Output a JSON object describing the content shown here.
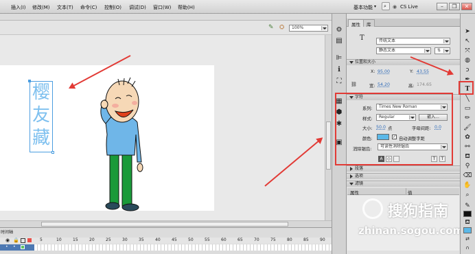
{
  "menubar": {
    "items": [
      "插入(I)",
      "修改(M)",
      "文本(T)",
      "命令(C)",
      "控制(O)",
      "调试(D)",
      "窗口(W)",
      "帮助(H)"
    ],
    "workspace": "基本功能",
    "cslive": "CS Live"
  },
  "editbar": {
    "zoom": "100%"
  },
  "stage": {
    "vertical_text": [
      "樱",
      "友",
      "藏"
    ]
  },
  "timeline": {
    "title": "时间轴",
    "frames": [
      "5",
      "10",
      "15",
      "20",
      "25",
      "30",
      "35",
      "40",
      "45",
      "50",
      "55",
      "60",
      "65",
      "70",
      "75",
      "80",
      "85",
      "90"
    ]
  },
  "properties": {
    "tabs": [
      "属性",
      "库"
    ],
    "tool_icon": "T",
    "text_engine": "传统文本",
    "text_type": "静态文本",
    "position_section": "位置和大小",
    "x_label": "X:",
    "x_value": "95.00",
    "y_label": "Y:",
    "y_value": "43.55",
    "w_label": "宽:",
    "w_value": "54.20",
    "h_label": "高:",
    "h_value": "174.65",
    "char_section": "字符",
    "family_label": "系列:",
    "family_value": "Times New Roman",
    "style_label": "样式:",
    "style_value": "Regular",
    "embed_button": "嵌入...",
    "size_label": "大小:",
    "size_value": "50.0",
    "size_unit": "点",
    "spacing_label": "字母间距:",
    "spacing_value": "0.0",
    "color_label": "颜色:",
    "color_value": "#5bb8e8",
    "autokern_label": "自动调整字距",
    "autokern_checked": true,
    "antialias_label": "消除锯齿:",
    "antialias_value": "可读性消除锯齿",
    "paragraph_section": "段落",
    "options_section": "选项",
    "filters_section": "滤镜",
    "filter_col1": "属性",
    "filter_col2": "值"
  },
  "watermark": {
    "brand": "搜狗指南",
    "url": "zhinan.sogou.com"
  },
  "colors": {
    "accent_red": "#e23a35",
    "text_blue": "#2e6ab8"
  }
}
